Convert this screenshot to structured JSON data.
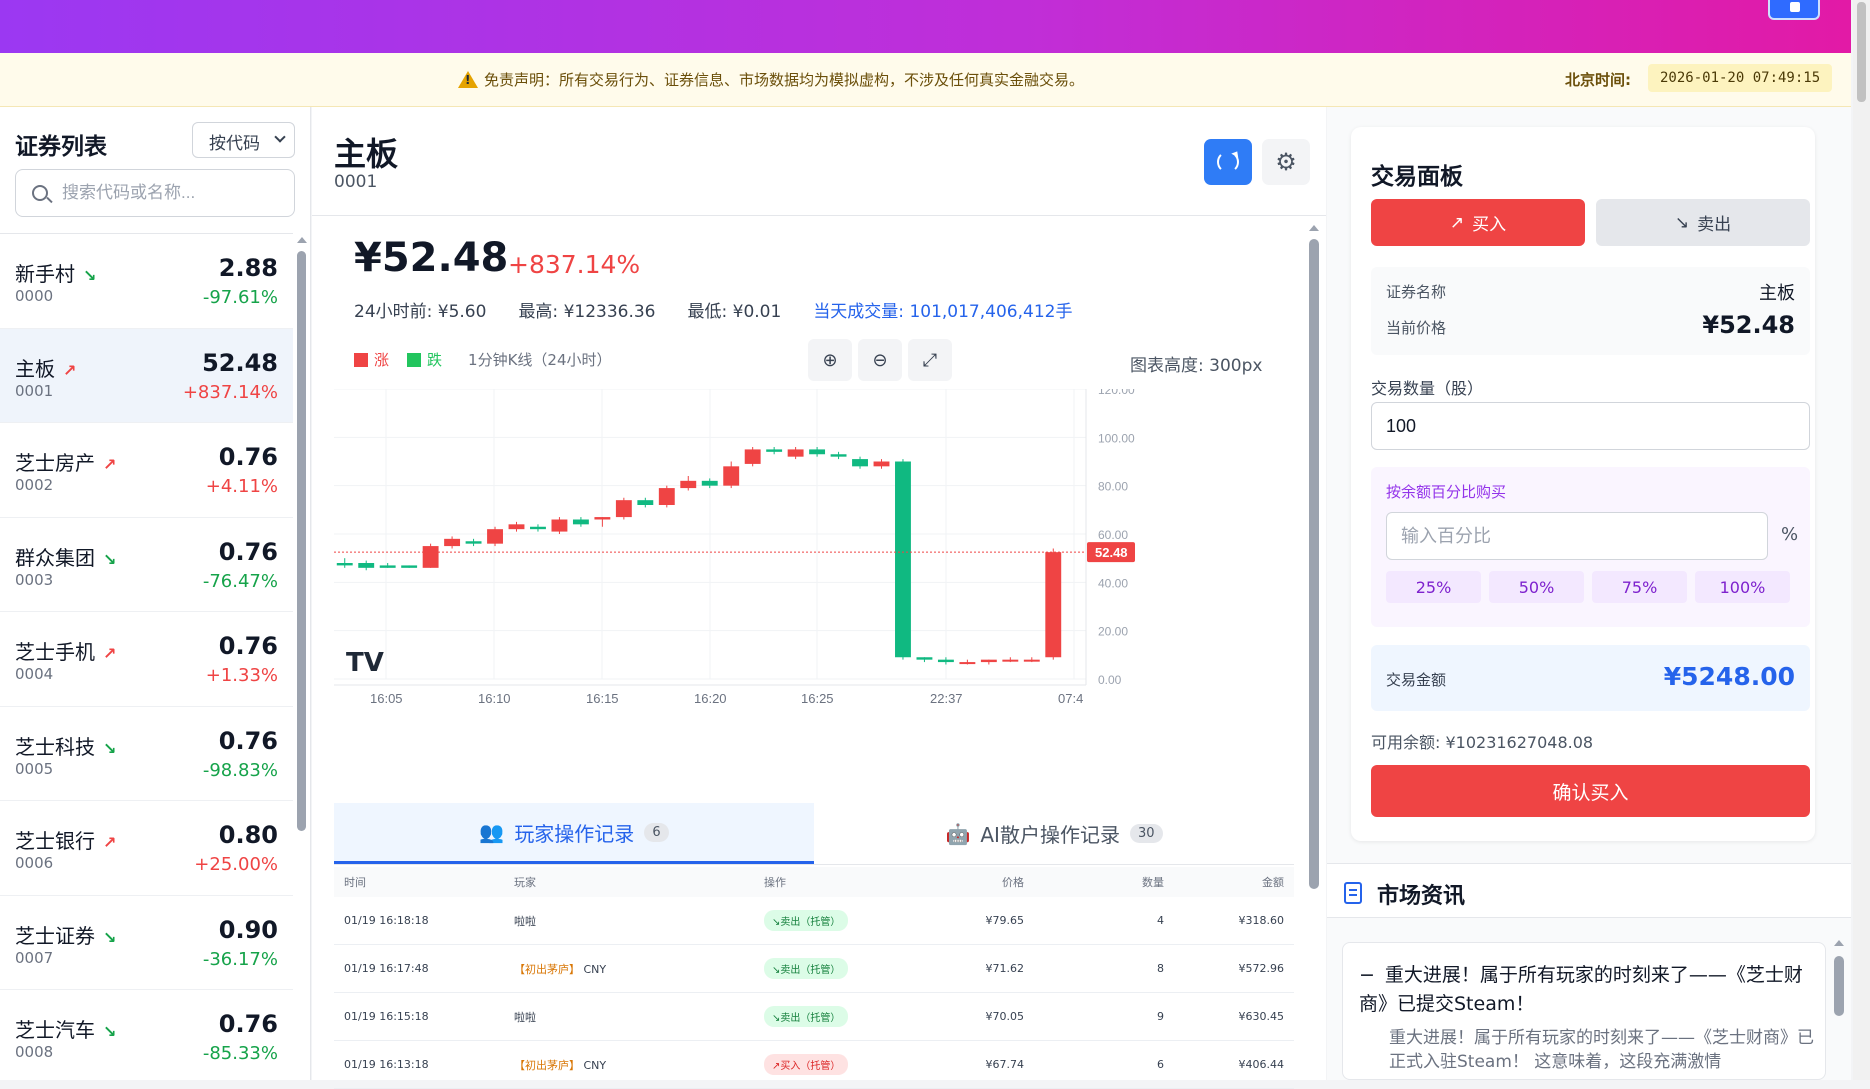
{
  "notice": {
    "disclaimer": "免责声明：所有交易行为、证券信息、市场数据均为模拟虚构，不涉及任何真实金融交易。",
    "time_label": "北京时间:",
    "time_value": "2026-01-20 07:49:15"
  },
  "sidebar": {
    "title": "证券列表",
    "sort_value": "按代码",
    "search_placeholder": "搜索代码或名称...",
    "items": [
      {
        "name": "新手村",
        "code": "0000",
        "price": "2.88",
        "change": "-97.61%",
        "dir": "down"
      },
      {
        "name": "主板",
        "code": "0001",
        "price": "52.48",
        "change": "+837.14%",
        "dir": "up"
      },
      {
        "name": "芝士房产",
        "code": "0002",
        "price": "0.76",
        "change": "+4.11%",
        "dir": "up"
      },
      {
        "name": "群众集团",
        "code": "0003",
        "price": "0.76",
        "change": "-76.47%",
        "dir": "down"
      },
      {
        "name": "芝士手机",
        "code": "0004",
        "price": "0.76",
        "change": "+1.33%",
        "dir": "up"
      },
      {
        "name": "芝士科技",
        "code": "0005",
        "price": "0.76",
        "change": "-98.83%",
        "dir": "down"
      },
      {
        "name": "芝士银行",
        "code": "0006",
        "price": "0.80",
        "change": "+25.00%",
        "dir": "up"
      },
      {
        "name": "芝士证券",
        "code": "0007",
        "price": "0.90",
        "change": "-36.17%",
        "dir": "down"
      },
      {
        "name": "芝士汽车",
        "code": "0008",
        "price": "0.76",
        "change": "-85.33%",
        "dir": "down"
      }
    ]
  },
  "main": {
    "title": "主板",
    "code": "0001",
    "price": "¥52.48",
    "change": "+837.14%",
    "stats": {
      "prev": "24小时前: ¥5.60",
      "high": "最高: ¥12336.36",
      "low": "最低: ¥0.01",
      "volume": "当天成交量: 101,017,406,412手"
    },
    "legend_up": "涨",
    "legend_down": "跌",
    "kline_label": "1分钟K线（24小时）",
    "chart_height": "图表高度: 300px"
  },
  "chart_data": {
    "type": "candlestick",
    "ylim": [
      0,
      120
    ],
    "y_ticks": [
      "0.00",
      "20.00",
      "40.00",
      "60.00",
      "80.00",
      "100.00",
      "120.00"
    ],
    "x_ticks": [
      "16:05",
      "16:10",
      "16:15",
      "16:20",
      "16:25",
      "22:37",
      "07:4"
    ],
    "current_price": 52.48,
    "current_price_label": "52.48",
    "up_color": "#ef4444",
    "down_color": "#10b981",
    "watermark": "TV",
    "candles": [
      {
        "o": 48,
        "c": 47,
        "h": 50,
        "l": 46
      },
      {
        "o": 48,
        "c": 46,
        "h": 49,
        "l": 45
      },
      {
        "o": 47,
        "c": 46,
        "h": 48,
        "l": 46
      },
      {
        "o": 47,
        "c": 46,
        "h": 47,
        "l": 46
      },
      {
        "o": 46,
        "c": 55,
        "h": 56,
        "l": 46
      },
      {
        "o": 55,
        "c": 58,
        "h": 59,
        "l": 54
      },
      {
        "o": 57,
        "c": 56,
        "h": 58,
        "l": 55
      },
      {
        "o": 56,
        "c": 62,
        "h": 63,
        "l": 55
      },
      {
        "o": 62,
        "c": 64,
        "h": 65,
        "l": 61
      },
      {
        "o": 63,
        "c": 62,
        "h": 64,
        "l": 61
      },
      {
        "o": 61,
        "c": 66,
        "h": 67,
        "l": 60
      },
      {
        "o": 66,
        "c": 64,
        "h": 67,
        "l": 63
      },
      {
        "o": 66,
        "c": 67,
        "h": 67,
        "l": 63
      },
      {
        "o": 67,
        "c": 74,
        "h": 75,
        "l": 66
      },
      {
        "o": 74,
        "c": 72,
        "h": 75,
        "l": 71
      },
      {
        "o": 72,
        "c": 79,
        "h": 80,
        "l": 71
      },
      {
        "o": 79,
        "c": 82,
        "h": 84,
        "l": 78
      },
      {
        "o": 82,
        "c": 80,
        "h": 83,
        "l": 79
      },
      {
        "o": 80,
        "c": 88,
        "h": 90,
        "l": 79
      },
      {
        "o": 89,
        "c": 95,
        "h": 96,
        "l": 88
      },
      {
        "o": 95,
        "c": 94,
        "h": 96,
        "l": 93
      },
      {
        "o": 92,
        "c": 95,
        "h": 96,
        "l": 91
      },
      {
        "o": 95,
        "c": 93,
        "h": 96,
        "l": 92
      },
      {
        "o": 93,
        "c": 92,
        "h": 94,
        "l": 91
      },
      {
        "o": 91,
        "c": 88,
        "h": 92,
        "l": 87
      },
      {
        "o": 88,
        "c": 90,
        "h": 91,
        "l": 87
      },
      {
        "o": 90,
        "c": 9,
        "h": 91,
        "l": 8
      },
      {
        "o": 9,
        "c": 8,
        "h": 9,
        "l": 7
      },
      {
        "o": 8,
        "c": 7,
        "h": 9,
        "l": 6
      },
      {
        "o": 7,
        "c": 7,
        "h": 8,
        "l": 6
      },
      {
        "o": 7,
        "c": 8,
        "h": 8,
        "l": 6
      },
      {
        "o": 8,
        "c": 8,
        "h": 9,
        "l": 7
      },
      {
        "o": 8,
        "c": 8,
        "h": 9,
        "l": 7
      },
      {
        "o": 9,
        "c": 52.48,
        "h": 54,
        "l": 8
      }
    ]
  },
  "tabs": [
    {
      "label": "玩家操作记录",
      "count": "6"
    },
    {
      "label": "AI散户操作记录",
      "count": "30"
    }
  ],
  "table": {
    "headers": [
      "时间",
      "玩家",
      "操作",
      "价格",
      "数量",
      "金额"
    ],
    "rows": [
      {
        "time": "01/19 16:18:18",
        "tag": "",
        "player": "啦啦",
        "op": "卖出（托管）",
        "type": "sell",
        "price": "¥79.65",
        "qty": "4",
        "amount": "¥318.60"
      },
      {
        "time": "01/19 16:17:48",
        "tag": "【初出茅庐】",
        "player": "CNY",
        "op": "卖出（托管）",
        "type": "sell",
        "price": "¥71.62",
        "qty": "8",
        "amount": "¥572.96"
      },
      {
        "time": "01/19 16:15:18",
        "tag": "",
        "player": "啦啦",
        "op": "卖出（托管）",
        "type": "sell",
        "price": "¥70.05",
        "qty": "9",
        "amount": "¥630.45"
      },
      {
        "time": "01/19 16:13:18",
        "tag": "【初出茅庐】",
        "player": "CNY",
        "op": "买入（托管）",
        "type": "buy",
        "price": "¥67.74",
        "qty": "6",
        "amount": "¥406.44"
      }
    ]
  },
  "trade_panel": {
    "title": "交易面板",
    "buy_label": "买入",
    "sell_label": "卖出",
    "name_label": "证券名称",
    "name_value": "主板",
    "price_label": "当前价格",
    "price_value": "¥52.48",
    "qty_label": "交易数量（股）",
    "qty_value": "100",
    "pct_label": "按余额百分比购买",
    "pct_placeholder": "输入百分比",
    "pct_unit": "%",
    "pct_buttons": [
      "25%",
      "50%",
      "75%",
      "100%"
    ],
    "amount_label": "交易金额",
    "amount_value": "¥5248.00",
    "balance": "可用余额: ¥10231627048.08",
    "confirm": "确认买入"
  },
  "news": {
    "title": "市场资讯",
    "item_title": "重大进展！属于所有玩家的时刻来了——《芝士财商》已提交Steam！",
    "item_body": "重大进展！属于所有玩家的时刻来了——《芝士财商》已正式入驻Steam！ 这意味着，这段充满激情"
  }
}
